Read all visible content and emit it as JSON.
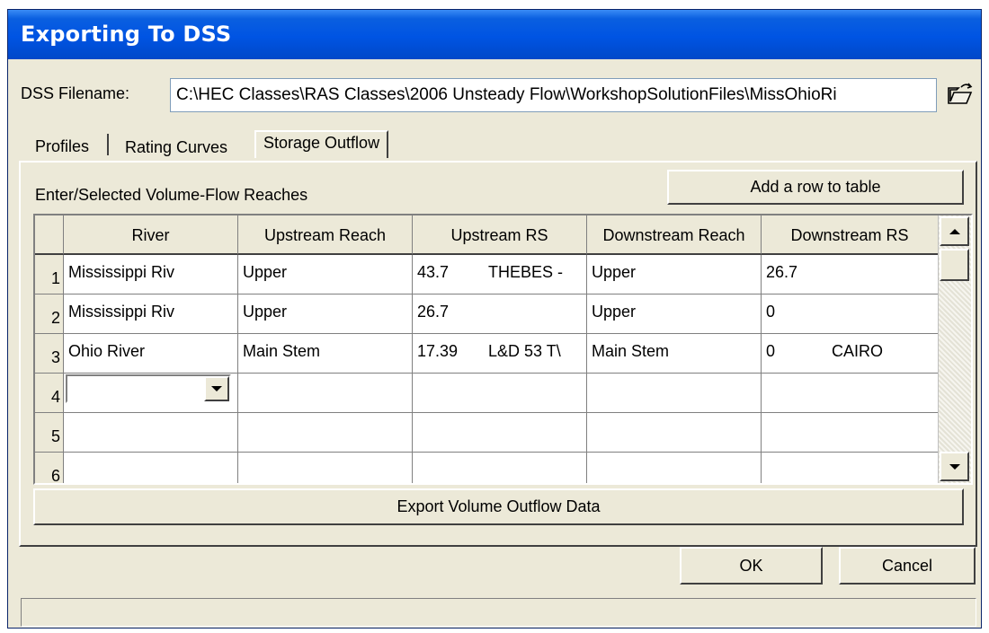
{
  "window": {
    "title": "Exporting To DSS"
  },
  "file": {
    "label": "DSS Filename:",
    "value": "C:\\HEC Classes\\RAS Classes\\2006 Unsteady Flow\\WorkshopSolutionFiles\\MissOhioRi",
    "open_icon": "folder-open-icon"
  },
  "tabs": [
    {
      "label": "Profiles"
    },
    {
      "label": "Rating Curves"
    },
    {
      "label": "Storage Outflow",
      "active": true
    }
  ],
  "panel": {
    "heading": "Enter/Selected Volume-Flow Reaches",
    "add_row_label": "Add a row to table",
    "export_label": "Export Volume Outflow Data"
  },
  "table": {
    "columns": [
      "River",
      "Upstream Reach",
      "Upstream RS",
      "Downstream Reach",
      "Downstream RS"
    ],
    "rows": [
      {
        "num": "1",
        "river": "Mississippi Riv",
        "up_reach": "Upper",
        "up_rs": "43.7",
        "up_rs_desc": "THEBES -",
        "down_reach": "Upper",
        "down_rs": "26.7",
        "down_rs_desc": ""
      },
      {
        "num": "2",
        "river": "Mississippi Riv",
        "up_reach": "Upper",
        "up_rs": "26.7",
        "up_rs_desc": "",
        "down_reach": "Upper",
        "down_rs": "0",
        "down_rs_desc": ""
      },
      {
        "num": "3",
        "river": "Ohio River",
        "up_reach": "Main Stem",
        "up_rs": "17.39",
        "up_rs_desc": "L&D 53 T\\",
        "down_reach": "Main Stem",
        "down_rs": "0",
        "down_rs_desc": "CAIRO"
      },
      {
        "num": "4",
        "river": "",
        "up_reach": "",
        "up_rs": "",
        "up_rs_desc": "",
        "down_reach": "",
        "down_rs": "",
        "down_rs_desc": ""
      },
      {
        "num": "5",
        "river": "",
        "up_reach": "",
        "up_rs": "",
        "up_rs_desc": "",
        "down_reach": "",
        "down_rs": "",
        "down_rs_desc": ""
      },
      {
        "num": "6",
        "river": "",
        "up_reach": "",
        "up_rs": "",
        "up_rs_desc": "",
        "down_reach": "",
        "down_rs": "",
        "down_rs_desc": ""
      }
    ]
  },
  "buttons": {
    "ok": "OK",
    "cancel": "Cancel"
  },
  "status": {
    "text": ""
  }
}
